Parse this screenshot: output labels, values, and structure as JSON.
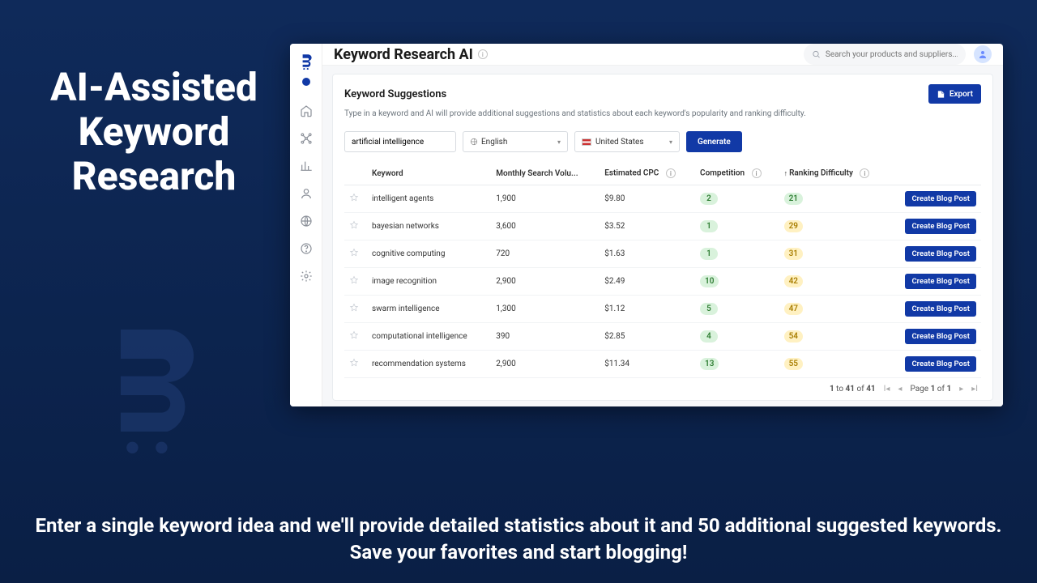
{
  "hero": {
    "title_line1": "AI-Assisted",
    "title_line2": "Keyword",
    "title_line3": "Research",
    "subtitle": "Enter a single keyword idea and we'll provide detailed statistics about it and 50 additional suggested keywords. Save your favorites and start blogging!"
  },
  "header": {
    "page_title": "Keyword Research AI",
    "search_placeholder": "Search your products and suppliers..."
  },
  "card": {
    "title": "Keyword Suggestions",
    "subtitle": "Type in a keyword and AI will provide additional suggestions and statistics about each keyword's popularity and ranking difficulty.",
    "export_label": "Export",
    "keyword_value": "artificial intelligence",
    "language_value": "English",
    "country_value": "United States",
    "generate_label": "Generate"
  },
  "table": {
    "columns": {
      "keyword": "Keyword",
      "volume": "Monthly Search Volu...",
      "cpc": "Estimated CPC",
      "competition": "Competition",
      "difficulty": "Ranking Difficulty"
    },
    "row_action": "Create Blog Post",
    "rows": [
      {
        "keyword": "intelligent agents",
        "volume": "1,900",
        "cpc": "$9.80",
        "competition": "2",
        "comp_color": "green",
        "difficulty": "21",
        "diff_color": "green"
      },
      {
        "keyword": "bayesian networks",
        "volume": "3,600",
        "cpc": "$3.52",
        "competition": "1",
        "comp_color": "green",
        "difficulty": "29",
        "diff_color": "yellow"
      },
      {
        "keyword": "cognitive computing",
        "volume": "720",
        "cpc": "$1.63",
        "competition": "1",
        "comp_color": "green",
        "difficulty": "31",
        "diff_color": "yellow"
      },
      {
        "keyword": "image recognition",
        "volume": "2,900",
        "cpc": "$2.49",
        "competition": "10",
        "comp_color": "green",
        "difficulty": "42",
        "diff_color": "yellow"
      },
      {
        "keyword": "swarm intelligence",
        "volume": "1,300",
        "cpc": "$1.12",
        "competition": "5",
        "comp_color": "green",
        "difficulty": "47",
        "diff_color": "yellow"
      },
      {
        "keyword": "computational intelligence",
        "volume": "390",
        "cpc": "$2.85",
        "competition": "4",
        "comp_color": "green",
        "difficulty": "54",
        "diff_color": "yellow"
      },
      {
        "keyword": "recommendation systems",
        "volume": "2,900",
        "cpc": "$11.34",
        "competition": "13",
        "comp_color": "green",
        "difficulty": "55",
        "diff_color": "yellow"
      }
    ]
  },
  "pager": {
    "range_prefix": "1",
    "range_to": "to",
    "range_end": "41",
    "range_of": "of",
    "range_total": "41",
    "page_label_prefix": "Page",
    "page_current": "1",
    "page_of": "of",
    "page_total": "1"
  },
  "colors": {
    "brand": "#1139a6"
  }
}
